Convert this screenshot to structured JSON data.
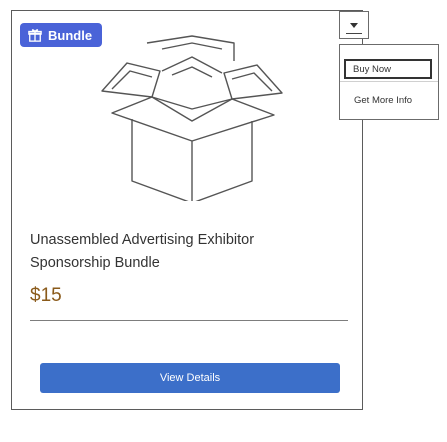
{
  "badge": {
    "label": "Bundle",
    "icon": "gift-icon",
    "color": "#4a63d8"
  },
  "product": {
    "title_line1": "Unassembled Advertising Exhibitor",
    "title_line2": "Sponsorship Bundle",
    "price": "$15",
    "image_icon": "open-box-icon"
  },
  "actions": {
    "view_details": "View Details"
  },
  "dropdown": {
    "items": [
      {
        "label": "Buy Now"
      },
      {
        "label": "Get More Info"
      }
    ]
  }
}
